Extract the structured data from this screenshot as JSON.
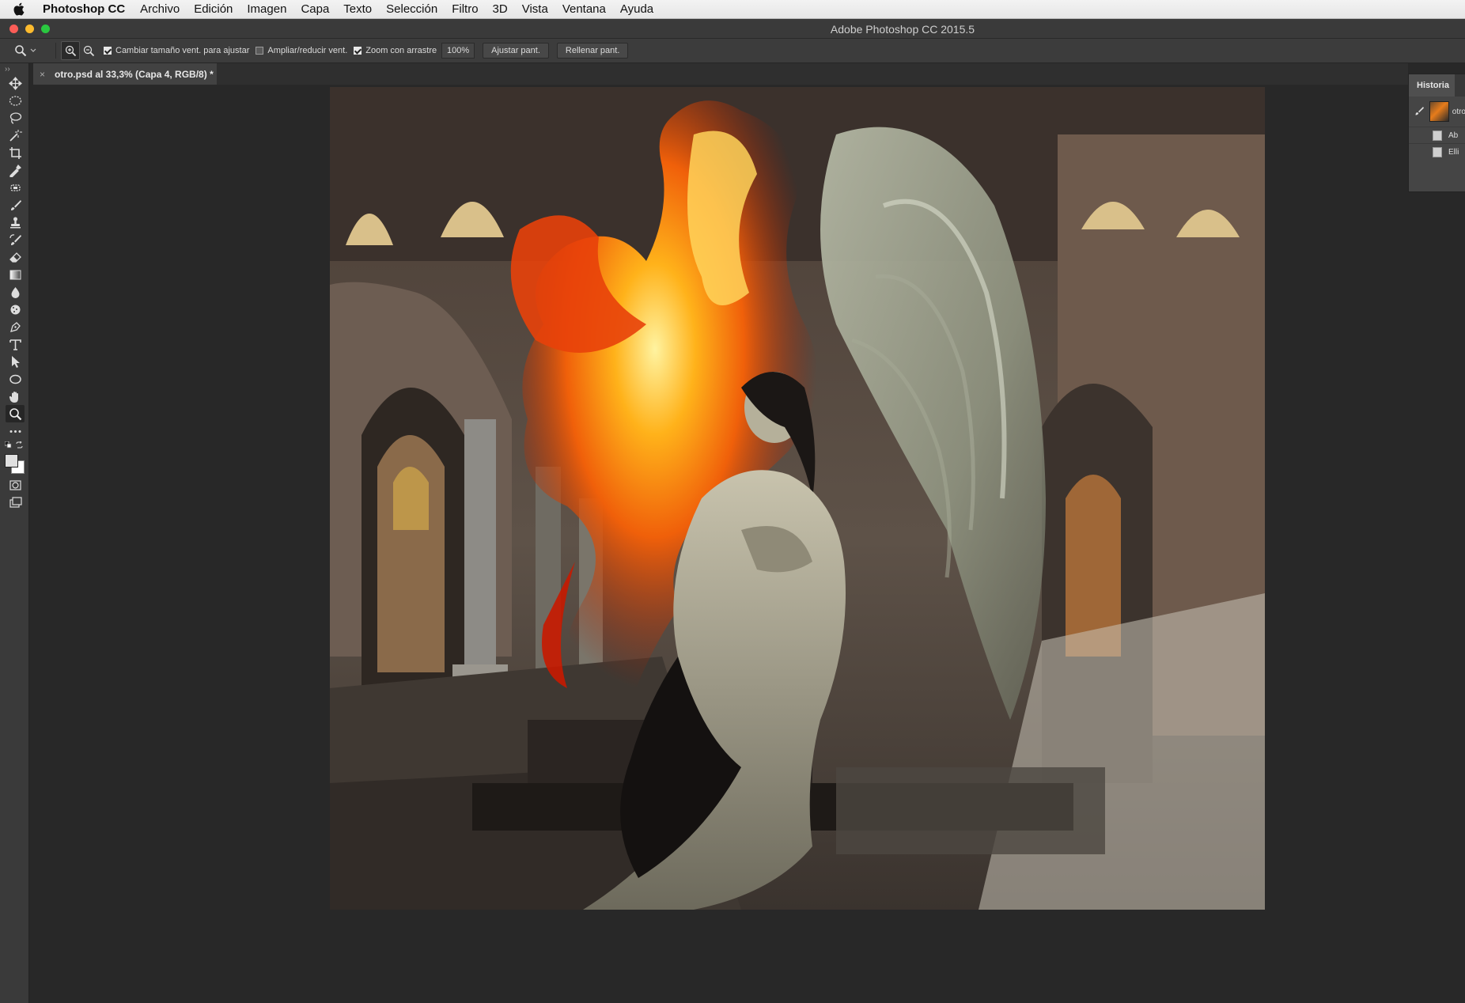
{
  "menubar": {
    "app_name": "Photoshop CC",
    "items": [
      "Archivo",
      "Edición",
      "Imagen",
      "Capa",
      "Texto",
      "Selección",
      "Filtro",
      "3D",
      "Vista",
      "Ventana",
      "Ayuda"
    ]
  },
  "window": {
    "title": "Adobe Photoshop CC 2015.5"
  },
  "options": {
    "resize_windows_label": "Cambiar tamaño vent. para ajustar",
    "zoom_all_windows_label": "Ampliar/reducir vent.",
    "scrubby_zoom_label": "Zoom con arrastre",
    "zoom_value": "100%",
    "fit_screen_label": "Ajustar pant.",
    "fill_screen_label": "Rellenar pant.",
    "resize_windows_checked": true,
    "zoom_all_windows_checked": false,
    "scrubby_zoom_checked": true
  },
  "document": {
    "tab_close": "×",
    "tab_label": "otro.psd al 33,3% (Capa 4, RGB/8) *"
  },
  "toolbar": {
    "tools": [
      "move-tool",
      "marquee-tool",
      "lasso-tool",
      "magic-wand-tool",
      "crop-tool",
      "eyedropper-tool",
      "healing-brush-tool",
      "brush-tool",
      "clone-stamp-tool",
      "history-brush-tool",
      "eraser-tool",
      "gradient-tool",
      "blur-tool",
      "dodge-tool",
      "pen-tool",
      "type-tool",
      "path-selection-tool",
      "ellipse-tool",
      "hand-tool",
      "zoom-tool",
      "more-tools"
    ],
    "active_tool": "zoom-tool",
    "foreground_color": "#e0e0e0",
    "background_color": "#ffffff"
  },
  "history": {
    "panel_title": "Historia",
    "snapshot_label": "otro",
    "items": [
      "Ab",
      "Elli"
    ]
  },
  "colors": {
    "accent": "#2a2a2a",
    "panel": "#454545",
    "background": "#282828"
  }
}
